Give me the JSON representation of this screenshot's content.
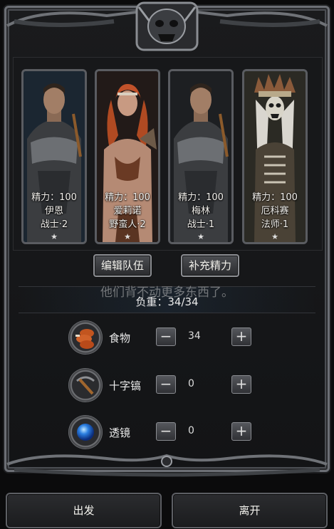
{
  "heroes": [
    {
      "stamina": "精力：100",
      "name": "伊恩",
      "class_level": "战士·2",
      "star": "★",
      "frame": "blue",
      "portrait": "warrior-portrait"
    },
    {
      "stamina": "精力：100",
      "name": "爱莉诺",
      "class_level": "野蛮人·2",
      "star": "★",
      "frame": "normal",
      "portrait": "barbarian-portrait"
    },
    {
      "stamina": "精力：100",
      "name": "梅林",
      "class_level": "战士·1",
      "star": "★",
      "frame": "normal",
      "portrait": "warrior-portrait"
    },
    {
      "stamina": "精力：100",
      "name": "厄科赛",
      "class_level": "法师·1",
      "star": "★",
      "frame": "green",
      "portrait": "shaman-portrait"
    }
  ],
  "actions": {
    "edit_team": "编辑队伍",
    "restore_stamina": "补充精力"
  },
  "toast": "他们背不动更多东西了。",
  "load": "负重：34/34",
  "items": [
    {
      "name": "食物",
      "count": "34",
      "icon": "food-icon"
    },
    {
      "name": "十字镐",
      "count": "0",
      "icon": "pickaxe-icon"
    },
    {
      "name": "透镜",
      "count": "0",
      "icon": "lens-icon"
    }
  ],
  "controls": {
    "minus": "−",
    "plus": "+"
  },
  "footer": {
    "depart": "出发",
    "leave": "离开"
  }
}
